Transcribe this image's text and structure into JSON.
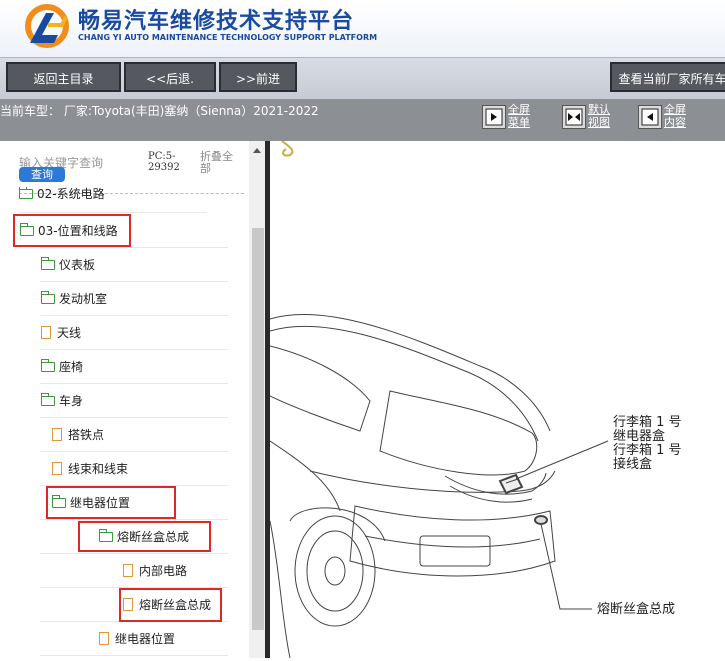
{
  "header": {
    "title": "畅易汽车维修技术支持平台",
    "subtitle": "CHANG YI AUTO MAINTENANCE TECHNOLOGY SUPPORT PLATFORM"
  },
  "nav": {
    "home": "返回主目录",
    "back": "<<后退.",
    "forward": ">>前进",
    "all_makes": "查看当前厂家所有车"
  },
  "status": {
    "car": "当前车型：  厂家:Toyota(丰田)塞纳（Sienna）2021-2022",
    "fullscreen_menu": [
      "全屏",
      "菜单"
    ],
    "default_view": [
      "默认",
      "视图"
    ],
    "fullscreen_content": [
      "全屏",
      "内容"
    ]
  },
  "sidebar": {
    "search_placeholder": "输入关键字查询",
    "query_button": "查询",
    "pc_info": [
      "PC:5-",
      "29392"
    ],
    "fold_all": "折叠全部",
    "items": [
      {
        "label": "02-系统电路",
        "icon": "folder-icon"
      },
      {
        "label": "03-位置和线路",
        "icon": "folder-open-icon"
      },
      {
        "label": "仪表板",
        "icon": "folder-icon"
      },
      {
        "label": "发动机室",
        "icon": "folder-icon"
      },
      {
        "label": "天线",
        "icon": "file-icon"
      },
      {
        "label": "座椅",
        "icon": "folder-icon"
      },
      {
        "label": "车身",
        "icon": "folder-open-icon"
      },
      {
        "label": "搭铁点",
        "icon": "file-icon"
      },
      {
        "label": "线束和线束",
        "icon": "file-icon"
      },
      {
        "label": "继电器位置",
        "icon": "folder-open-icon"
      },
      {
        "label": "熔断丝盒总成",
        "icon": "folder-open-icon"
      },
      {
        "label": "内部电路",
        "icon": "file-icon"
      },
      {
        "label": "熔断丝盒总成",
        "icon": "file-icon"
      },
      {
        "label": "继电器位置",
        "icon": "file-icon"
      }
    ]
  },
  "diagram": {
    "label1": [
      "行李箱 1 号",
      "继电器盒",
      "行李箱 1 号",
      "接线盒"
    ],
    "label2": "熔断丝盒总成"
  },
  "colors": {
    "brand": "#1a4aa0",
    "highlight": "#e02828",
    "query_button": "#2c7ad4"
  }
}
